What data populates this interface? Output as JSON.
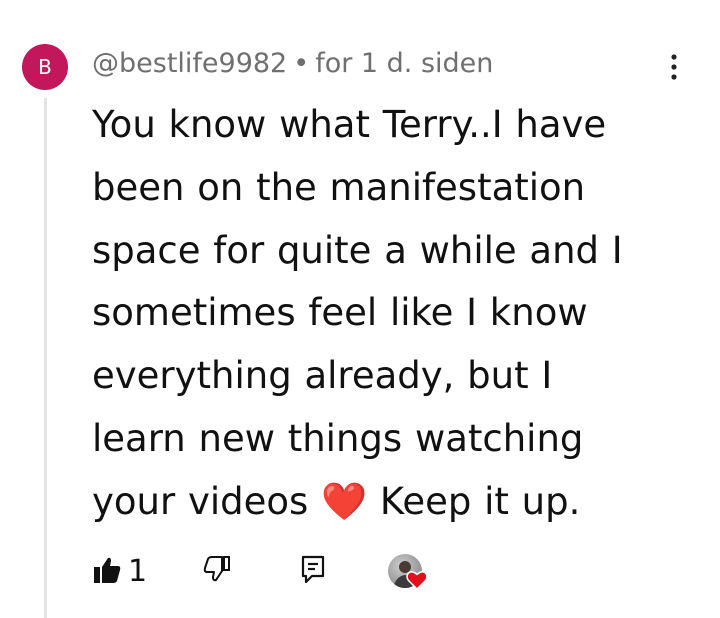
{
  "comment": {
    "avatar_letter": "B",
    "avatar_color": "#c2185b",
    "author": "@bestlife9982",
    "separator": "•",
    "timestamp": "for 1 d. siden",
    "text": "You know what Terry..I have\nbeen on the manifestation\nspace for quite a while and I\nsometimes  feel like I know\neverything  already, but I\nlearn new things  watching\nyour videos ",
    "emoji": "❤️",
    "text_end": " Keep it up.",
    "like_count": "1"
  },
  "icons": {
    "more": "more-vertical-icon",
    "like": "thumbs-up-filled-icon",
    "dislike": "thumbs-down-icon",
    "reply": "comment-reply-icon",
    "creator_heart": "creator-heart-badge"
  },
  "colors": {
    "text": "#111111",
    "meta": "#6f6f6f",
    "heart": "#e0101f",
    "thread_line": "#e4e4e4"
  }
}
